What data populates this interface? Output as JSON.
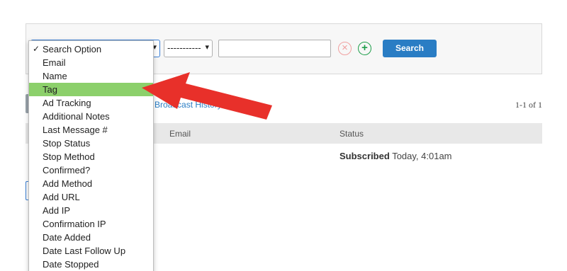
{
  "search": {
    "first_select": "",
    "second_select": "-----------",
    "search_button": "Search"
  },
  "toolbar": {
    "link_text": "Broadcast History",
    "pagination": "1-1 of 1"
  },
  "table": {
    "columns": [
      "Email",
      "Status"
    ],
    "row": {
      "status_bold": "Subscribed",
      "status_time": "Today, 4:01am"
    }
  },
  "dropdown": {
    "selected_check": "✓",
    "items": [
      "Search Option",
      "Email",
      "Name",
      "Tag",
      "Ad Tracking",
      "Additional Notes",
      "Last Message #",
      "Stop Status",
      "Stop Method",
      "Confirmed?",
      "Add Method",
      "Add URL",
      "Add IP",
      "Confirmation IP",
      "Date Added",
      "Date Last Follow Up",
      "Date Stopped"
    ],
    "highlight_color": "#8cd06b"
  },
  "annotation": {
    "arrow_color": "#e8302a"
  },
  "icons": {
    "remove": "circle-x-icon",
    "add": "circle-plus-icon"
  }
}
